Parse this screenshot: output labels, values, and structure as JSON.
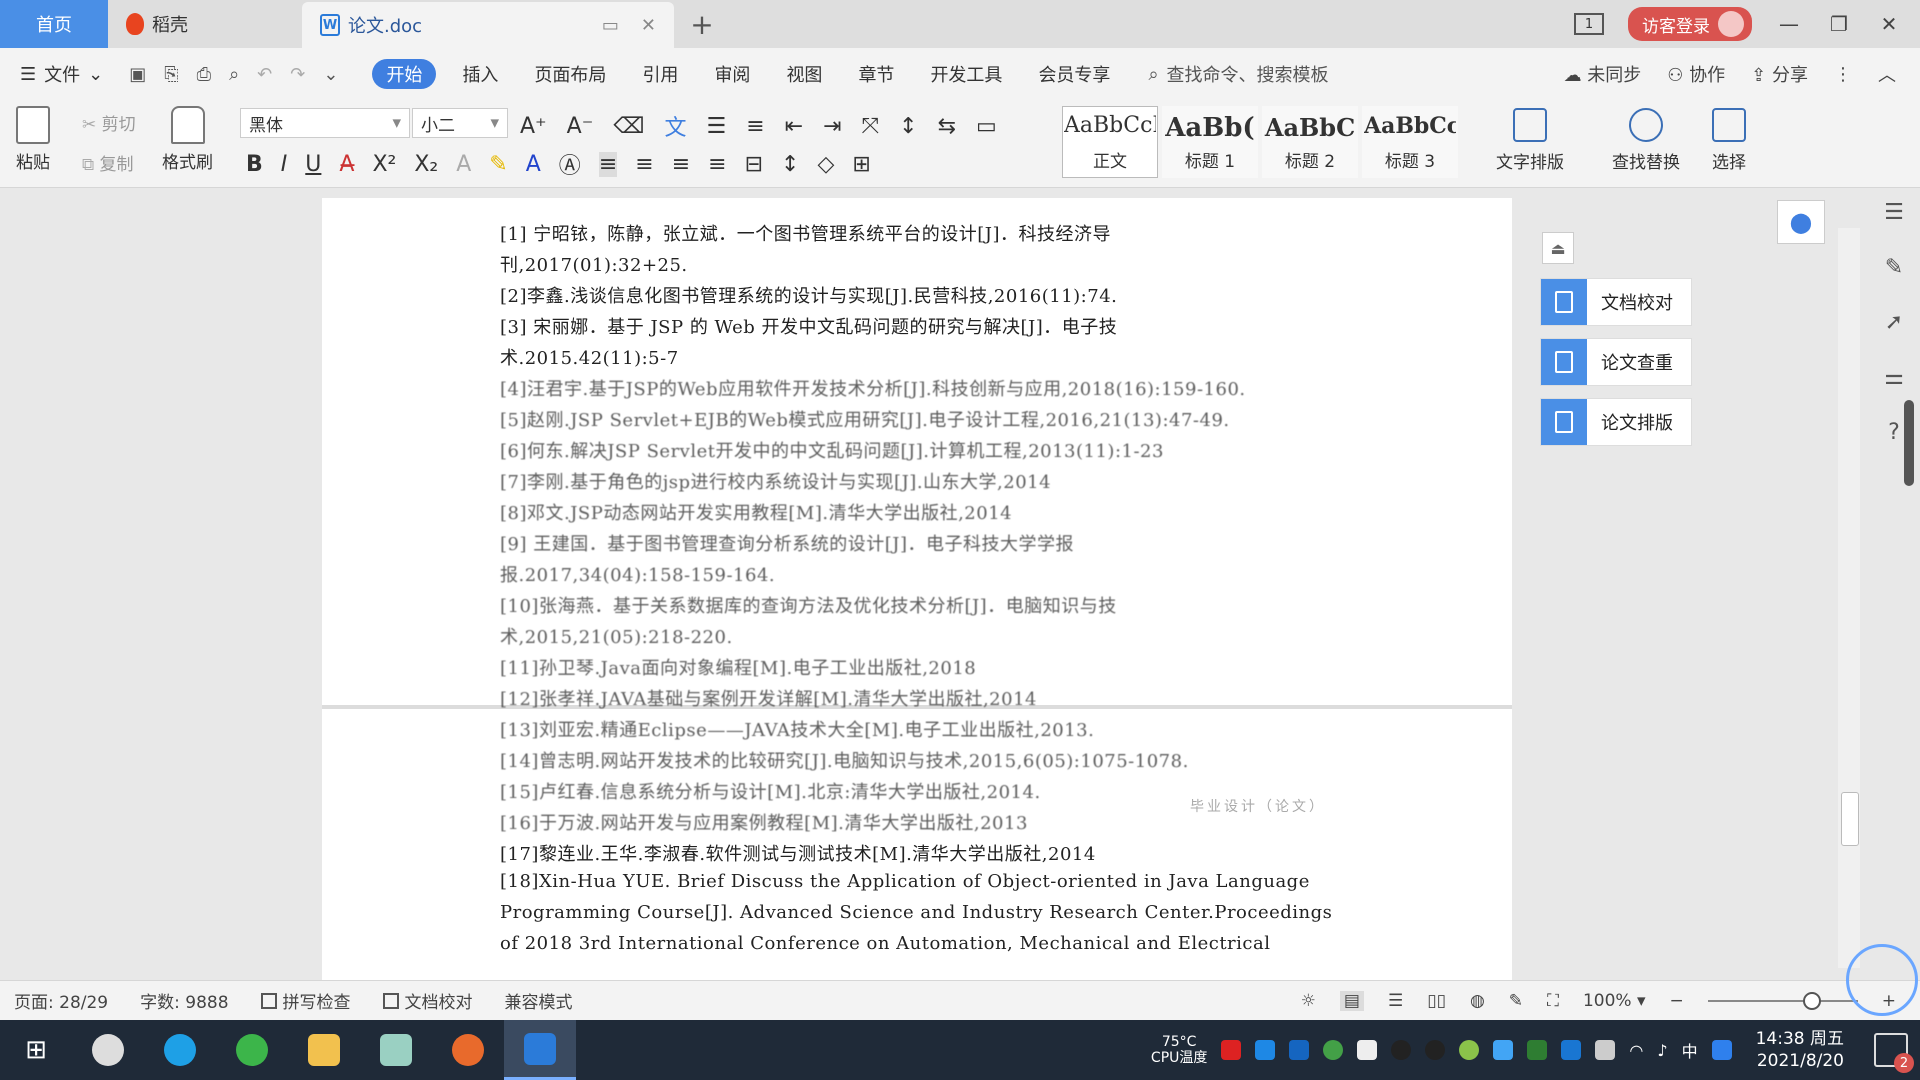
{
  "tabs": {
    "home": "首页",
    "daoke": "稻壳",
    "doc": "论文.doc",
    "add": "+"
  },
  "titlebar": {
    "window_num": "1",
    "visitor_login": "访客登录"
  },
  "menu": {
    "file": "文件",
    "items": [
      "开始",
      "插入",
      "页面布局",
      "引用",
      "审阅",
      "视图",
      "章节",
      "开发工具",
      "会员专享"
    ],
    "search_cmd": "查找命令、搜索模板",
    "unsynced": "未同步",
    "collab": "协作",
    "share": "分享"
  },
  "ribbon": {
    "paste": "粘贴",
    "cut": "剪切",
    "copy": "复制",
    "format_painter": "格式刷",
    "font_name": "黑体",
    "font_size": "小二",
    "styles": [
      {
        "preview": "AaBbCcI",
        "name": "正文"
      },
      {
        "preview": "AaBb(",
        "name": "标题 1"
      },
      {
        "preview": "AaBbC",
        "name": "标题 2"
      },
      {
        "preview": "AaBbCcl",
        "name": "标题 3"
      }
    ],
    "text_layout": "文字排版",
    "find_replace": "查找替换",
    "select": "选择"
  },
  "references": [
    "[1] 宁昭铱，陈静，张立斌．一个图书管理系统平台的设计[J]．科技经济导",
    "刊,2017(01):32+25.",
    "[2]李鑫.浅谈信息化图书管理系统的设计与实现[J].民营科技,2016(11):74.",
    "[3] 宋丽娜．基于 JSP 的 Web 开发中文乱码问题的研究与解决[J]．电子技",
    "术.2015.42(11):5-7",
    "[4]汪君宇.基于JSP的Web应用软件开发技术分析[J].科技创新与应用,2018(16):159-160.",
    "[5]赵刚.JSP Servlet+EJB的Web模式应用研究[J].电子设计工程,2016,21(13):47-49.",
    "[6]何东.解决JSP Servlet开发中的中文乱码问题[J].计算机工程,2013(11):1-23",
    "[7]李刚.基于角色的jsp进行校内系统设计与实现[J].山东大学,2014",
    "[8]邓文.JSP动态网站开发实用教程[M].清华大学出版社,2014",
    "[9] 王建国．基于图书管理查询分析系统的设计[J]．电子科技大学学报",
    "报.2017,34(04):158-159-164.",
    "[10]张海燕．基于关系数据库的查询方法及优化技术分析[J]．电脑知识与技",
    "术,2015,21(05):218-220.",
    "[11]孙卫琴.Java面向对象编程[M].电子工业出版社,2018",
    "[12]张孝祥.JAVA基础与案例开发详解[M].清华大学出版社,2014",
    "[13]刘亚宏.精通Eclipse——JAVA技术大全[M].电子工业出版社,2013.",
    "[14]曾志明.网站开发技术的比较研究[J].电脑知识与技术,2015,6(05):1075-1078.",
    "[15]卢红春.信息系统分析与设计[M].北京:清华大学出版社,2014.",
    "[16]于万波.网站开发与应用案例教程[M].清华大学出版社,2013",
    "[17]黎连业.王华.李淑春.软件测试与测试技术[M].清华大学出版社,2014",
    "[18]Xin-Hua YUE. Brief Discuss the Application of Object-oriented in Java Language",
    "Programming Course[J]. Advanced Science and Industry Research Center.Proceedings",
    "of 2018 3rd International Conference on Automation, Mechanical and Electrical"
  ],
  "footer_note": "毕业设计（论文）",
  "right_panel": {
    "proofread": "文档校对",
    "plagiarism": "论文查重",
    "layout": "论文排版"
  },
  "status": {
    "page": "页面: 28/29",
    "words": "字数: 9888",
    "spellcheck": "拼写检查",
    "doc_proof": "文档校对",
    "compat": "兼容模式",
    "zoom": "100%"
  },
  "taskbar": {
    "temp": "75°C",
    "cpu_label": "CPU温度",
    "ime": "中",
    "time": "14:38 周五",
    "date": "2021/8/20",
    "notif_count": "2"
  },
  "colors": {
    "accent": "#3f7fe0",
    "home_tab": "#4a8fe6",
    "visitor": "#d9534f",
    "taskbar": "#1f2a38"
  }
}
